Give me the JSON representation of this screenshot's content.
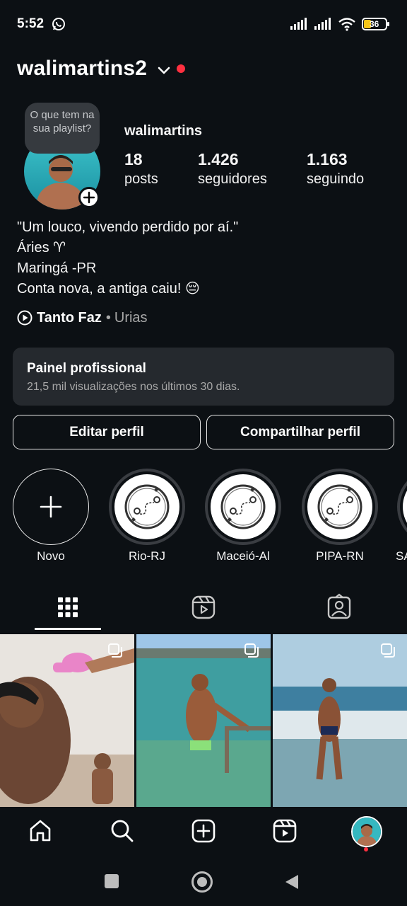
{
  "status_bar": {
    "time": "5:52",
    "battery": "36"
  },
  "header": {
    "username": "walimartins2"
  },
  "profile": {
    "note": "O que tem na sua playlist?",
    "display_name": "walimartins",
    "stats": [
      {
        "value": "18",
        "label": "posts"
      },
      {
        "value": "1.426",
        "label": "seguidores"
      },
      {
        "value": "1.163",
        "label": "seguindo"
      }
    ],
    "bio": [
      "\"Um louco, vivendo perdido por aí.\"",
      "Áries ♈",
      "Maringá -PR",
      "Conta nova, a antiga caiu! 😔"
    ],
    "music": {
      "song": "Tanto Faz",
      "separator": "•",
      "artist": "Urias"
    }
  },
  "dashboard": {
    "title": "Painel profissional",
    "subtitle": "21,5 mil visualizações nos últimos 30 dias."
  },
  "actions": {
    "edit": "Editar perfil",
    "share": "Compartilhar perfil"
  },
  "highlights": [
    {
      "label": "Novo",
      "icon": "plus-icon"
    },
    {
      "label": "Rio-RJ",
      "icon": "map-route-icon"
    },
    {
      "label": "Maceió-Al",
      "icon": "map-route-icon"
    },
    {
      "label": "PIPA-RN",
      "icon": "map-route-icon"
    },
    {
      "label": "SA",
      "icon": "map-route-icon"
    }
  ],
  "tabs": [
    {
      "name": "posts-grid",
      "icon": "grid-icon",
      "active": true
    },
    {
      "name": "reels",
      "icon": "reels-icon",
      "active": false
    },
    {
      "name": "tagged",
      "icon": "tagged-icon",
      "active": false
    }
  ],
  "bottom_nav": [
    "home-icon",
    "search-icon",
    "create-icon",
    "reels-icon",
    "profile-avatar"
  ],
  "colors": {
    "background": "#0c1014",
    "card": "#25292e",
    "notification": "#ff3040"
  }
}
